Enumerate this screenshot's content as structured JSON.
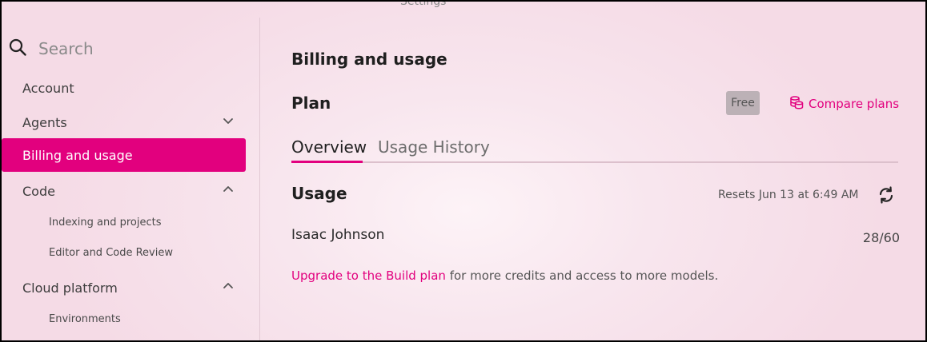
{
  "window": {
    "title": "Settings"
  },
  "search": {
    "placeholder": "Search"
  },
  "sidebar": {
    "items": [
      {
        "label": "Account"
      },
      {
        "label": "Agents"
      },
      {
        "label": "Billing and usage"
      },
      {
        "label": "Code"
      },
      {
        "label": "Indexing and projects"
      },
      {
        "label": "Editor and Code Review"
      },
      {
        "label": "Cloud platform"
      },
      {
        "label": "Environments"
      }
    ]
  },
  "main": {
    "heading": "Billing and usage",
    "plan": {
      "title": "Plan",
      "badge": "Free",
      "compare_label": "Compare plans"
    },
    "tabs": [
      {
        "label": "Overview",
        "selected": true
      },
      {
        "label": "Usage History",
        "selected": false
      }
    ],
    "usage": {
      "title": "Usage",
      "resets": "Resets Jun 13 at 6:49 AM",
      "user": "Isaac Johnson",
      "count": "28/60"
    },
    "upgrade": {
      "link": "Upgrade to the Build plan",
      "text": " for more credits and access to more models."
    }
  },
  "colors": {
    "accent": "#e2007e",
    "badge_bg": "#bcb1b6",
    "background": "#f8e6ee"
  },
  "icons": [
    "search-icon",
    "chevron-down-icon",
    "chevron-up-icon",
    "coins-icon",
    "refresh-icon"
  ]
}
